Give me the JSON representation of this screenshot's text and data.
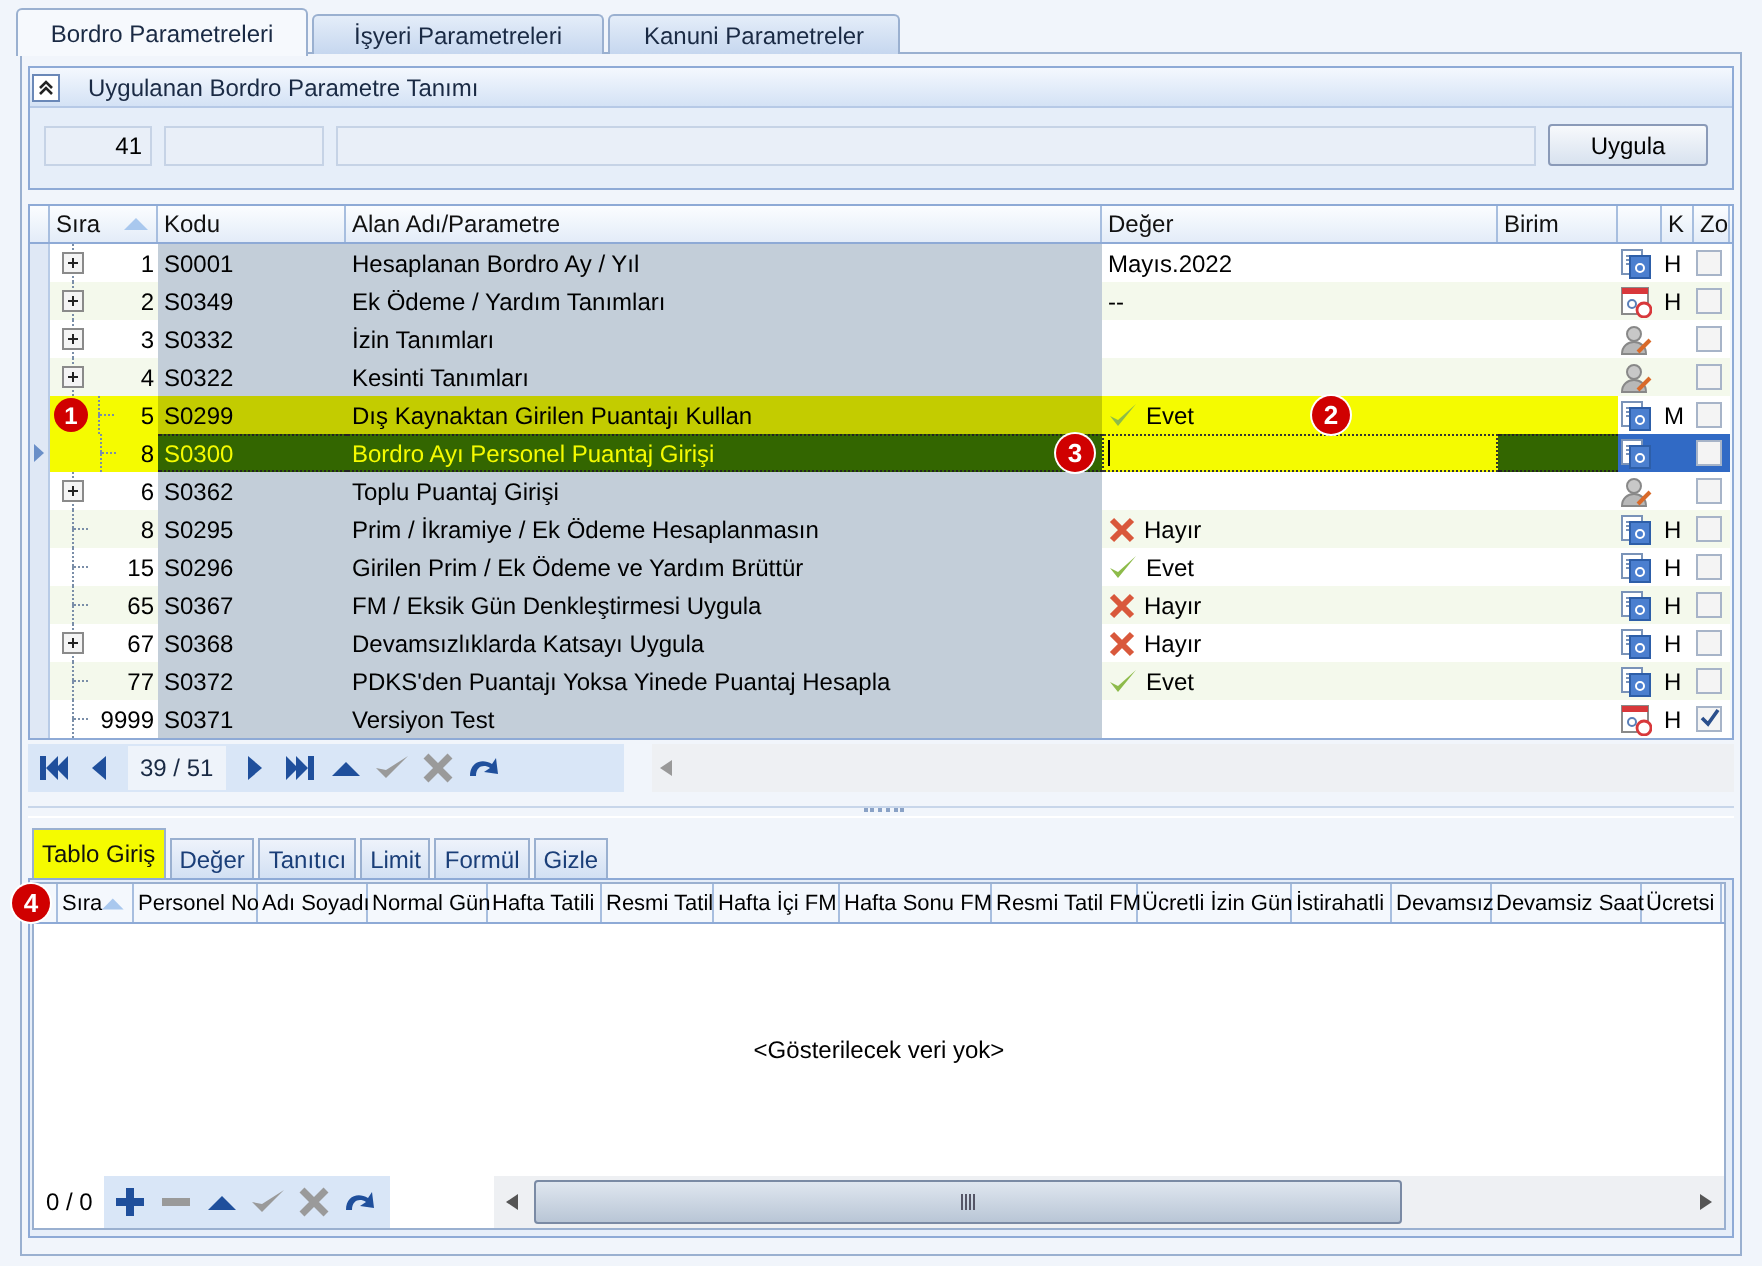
{
  "tabs": [
    {
      "label": "Bordro Parametreleri",
      "selected": true
    },
    {
      "label": "İşyeri Parametreleri",
      "selected": false
    },
    {
      "label": "Kanuni Parametreler",
      "selected": false
    }
  ],
  "group": {
    "title": "Uygulanan Bordro Parametre Tanımı",
    "number": "41",
    "button": "Uygula"
  },
  "grid": {
    "columns": [
      "Sıra",
      "Kodu",
      "Alan Adı/Parametre",
      "Değer",
      "Birim",
      "K",
      "Zo"
    ],
    "rows": [
      {
        "sira": "1",
        "kodu": "S0001",
        "name": "Hesaplanan Bordro Ay / Yıl",
        "value": {
          "kind": "text",
          "text": "Mayıs.2022"
        },
        "kind": "document",
        "ka": "H",
        "zor": false,
        "expanded": false,
        "marked": false,
        "selected": false
      },
      {
        "sira": "2",
        "kodu": "S0349",
        "name": "Ek Ödeme / Yardım Tanımları",
        "value": {
          "kind": "text",
          "text": "--"
        },
        "kind": "calendar",
        "ka": "H",
        "zor": false,
        "expanded": false,
        "marked": false,
        "selected": false
      },
      {
        "sira": "3",
        "kodu": "S0332",
        "name": "İzin Tanımları",
        "kind": "user",
        "zor": false,
        "expanded": false,
        "marked": false,
        "selected": false
      },
      {
        "sira": "4",
        "kodu": "S0322",
        "name": "Kesinti Tanımları",
        "kind": "user",
        "zor": false,
        "expanded": false,
        "marked": false,
        "selected": false
      },
      {
        "sira": "5",
        "kodu": "S0299",
        "name": "Dış Kaynaktan Girilen Puantajı Kullan",
        "value": {
          "kind": "yes",
          "text": "Evet"
        },
        "kind": "document",
        "ka": "M",
        "zor": false,
        "marked": true,
        "selected": false,
        "children": [
          {
            "sira": "8",
            "kodu": "S0300",
            "name": "Bordro Ayı Personel Puantaj Girişi",
            "value": {
              "kind": "editing"
            },
            "kind": "document",
            "zor": false,
            "marked": false,
            "selected": true
          }
        ]
      },
      {
        "sira": "6",
        "kodu": "S0362",
        "name": "Toplu Puantaj Girişi",
        "kind": "user",
        "zor": false,
        "expanded": false,
        "marked": false,
        "selected": false
      },
      {
        "sira": "8",
        "kodu": "S0295",
        "name": "Prim / İkramiye / Ek Ödeme Hesaplanmasın",
        "value": {
          "kind": "no",
          "text": "Hayır"
        },
        "kind": "document",
        "ka": "H",
        "zor": false,
        "marked": false,
        "selected": false
      },
      {
        "sira": "15",
        "kodu": "S0296",
        "name": "Girilen Prim /  Ek Ödeme ve Yardım Brüttür",
        "value": {
          "kind": "yes",
          "text": "Evet"
        },
        "kind": "document",
        "ka": "H",
        "zor": false,
        "marked": false,
        "selected": false
      },
      {
        "sira": "65",
        "kodu": "S0367",
        "name": "FM / Eksik Gün Denkleştirmesi Uygula",
        "value": {
          "kind": "no",
          "text": "Hayır"
        },
        "kind": "document",
        "ka": "H",
        "zor": false,
        "marked": false,
        "selected": false
      },
      {
        "sira": "67",
        "kodu": "S0368",
        "name": "Devamsızlıklarda Katsayı Uygula",
        "value": {
          "kind": "no",
          "text": "Hayır"
        },
        "kind": "document",
        "ka": "H",
        "zor": false,
        "expanded": false,
        "marked": false,
        "selected": false
      },
      {
        "sira": "77",
        "kodu": "S0372",
        "name": "PDKS'den Puantajı Yoksa Yinede Puantaj Hesapla",
        "value": {
          "kind": "yes",
          "text": "Evet"
        },
        "kind": "document",
        "ka": "H",
        "zor": false,
        "marked": false,
        "selected": false
      },
      {
        "sira": "9999",
        "kodu": "S0371",
        "name": "Versiyon Test",
        "kind": "calendar",
        "ka": "H",
        "zor": true,
        "marked": false,
        "selected": false
      }
    ]
  },
  "navigator": {
    "position": "39 / 51",
    "buttons": [
      {
        "kind": "first",
        "disabled": false
      },
      {
        "kind": "prev",
        "disabled": false
      },
      {
        "kind": "next",
        "disabled": false
      },
      {
        "kind": "last",
        "disabled": false
      },
      {
        "kind": "up",
        "disabled": false
      },
      {
        "kind": "check",
        "disabled": true
      },
      {
        "kind": "cancel",
        "disabled": true
      },
      {
        "kind": "refresh",
        "disabled": false
      }
    ]
  },
  "bottom_tabs": [
    {
      "label": "Tablo Giriş",
      "selected": true
    },
    {
      "label": "Değer",
      "selected": false
    },
    {
      "label": "Tanıtıcı",
      "selected": false
    },
    {
      "label": "Limit",
      "selected": false
    },
    {
      "label": "Formül",
      "selected": false
    },
    {
      "label": "Gizle",
      "selected": false
    }
  ],
  "bottom_grid": {
    "columns": [
      "Sıra",
      "Personel No",
      "Adı Soyadı",
      "Normal Gün",
      "Hafta Tatili",
      "Resmi Tatil",
      "Hafta İçi FM",
      "Hafta Sonu FM",
      "Resmi Tatil FM",
      "Ücretli İzin Gün",
      "İstirahatli",
      "Devamsız",
      "Devamsiz Saat",
      "Ücretsi"
    ],
    "empty_text": "<Gösterilecek veri yok>",
    "navigator": {
      "position": "0 / 0",
      "buttons": [
        {
          "kind": "add",
          "disabled": false
        },
        {
          "kind": "remove",
          "disabled": true
        },
        {
          "kind": "up",
          "disabled": false
        },
        {
          "kind": "check",
          "disabled": true
        },
        {
          "kind": "cancel",
          "disabled": true
        },
        {
          "kind": "refresh",
          "disabled": false
        }
      ]
    }
  },
  "callouts": [
    "1",
    "2",
    "3",
    "4"
  ]
}
